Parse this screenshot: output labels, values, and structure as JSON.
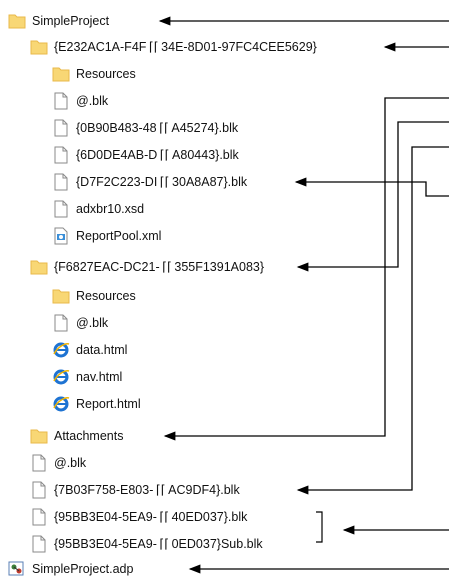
{
  "tree": {
    "items": [
      {
        "label": "SimpleProject",
        "icon": "folder-icon"
      },
      {
        "label": "{E232AC1A-F4F ⌈⌈ 34E-8D01-97FC4CEE5629}",
        "icon": "folder-icon"
      },
      {
        "label": "Resources",
        "icon": "folder-icon"
      },
      {
        "label": "@.blk",
        "icon": "file-icon"
      },
      {
        "label": "{0B90B483-48 ⌈⌈ A45274}.blk",
        "icon": "file-icon"
      },
      {
        "label": "{6D0DE4AB-D ⌈⌈ A80443}.blk",
        "icon": "file-icon"
      },
      {
        "label": "{D7F2C223-DI ⌈⌈ 30A8A87}.blk",
        "icon": "file-icon"
      },
      {
        "label": "adxbr10.xsd",
        "icon": "file-icon"
      },
      {
        "label": "ReportPool.xml",
        "icon": "xml-file-icon"
      },
      {
        "label": "{F6827EAC-DC21- ⌈⌈ 355F1391A083}",
        "icon": "folder-icon"
      },
      {
        "label": "Resources",
        "icon": "folder-icon"
      },
      {
        "label": "@.blk",
        "icon": "file-icon"
      },
      {
        "label": "data.html",
        "icon": "html-file-icon"
      },
      {
        "label": "nav.html",
        "icon": "html-file-icon"
      },
      {
        "label": "Report.html",
        "icon": "html-file-icon"
      },
      {
        "label": "Attachments",
        "icon": "folder-icon"
      },
      {
        "label": "@.blk",
        "icon": "file-icon"
      },
      {
        "label": "{7B03F758-E803- ⌈⌈ AC9DF4}.blk",
        "icon": "file-icon"
      },
      {
        "label": "{95BB3E04-5EA9- ⌈⌈ 40ED037}.blk",
        "icon": "file-icon"
      },
      {
        "label": "{95BB3E04-5EA9- ⌈⌈ 0ED037}Sub.blk",
        "icon": "file-icon"
      },
      {
        "label": "SimpleProject.adp",
        "icon": "project-file-icon"
      }
    ]
  },
  "colors": {
    "folder": "#F8D775",
    "folder_shade": "#E9B94A",
    "file_border": "#8A8A8A",
    "ie_blue": "#1E73D2",
    "arrow": "#000000"
  }
}
